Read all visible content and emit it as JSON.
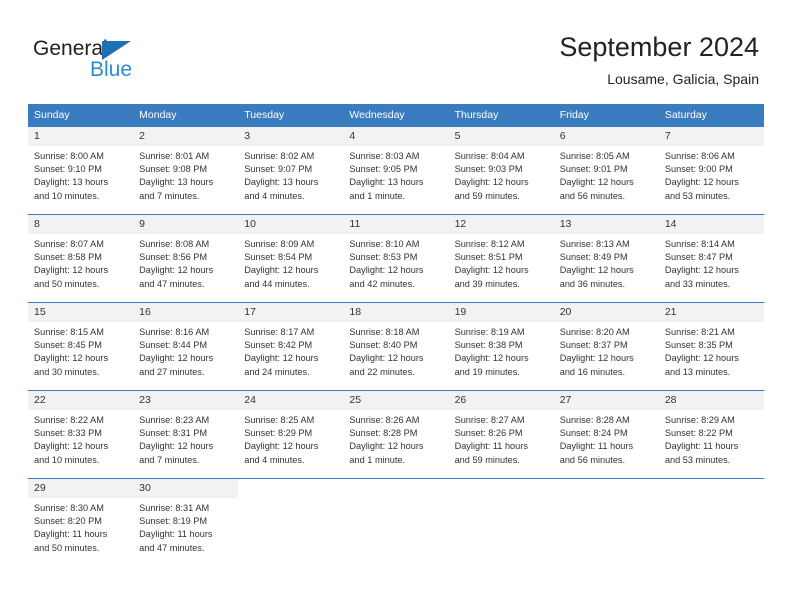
{
  "logo": {
    "word_one": "General",
    "word_two": "Blue",
    "triangle_color": "#1f6fb5",
    "blue_color": "#2e8bd0"
  },
  "header": {
    "month_title": "September 2024",
    "location": "Lousame, Galicia, Spain"
  },
  "theme": {
    "header_row_bg": "#3a7cc0",
    "daynum_bg": "#f2f2f2",
    "text_color": "#333333"
  },
  "calendar": {
    "weekday_headers": [
      "Sunday",
      "Monday",
      "Tuesday",
      "Wednesday",
      "Thursday",
      "Friday",
      "Saturday"
    ],
    "weeks": [
      [
        {
          "day": "1",
          "sunrise": "Sunrise: 8:00 AM",
          "sunset": "Sunset: 9:10 PM",
          "daylight_line1": "Daylight: 13 hours",
          "daylight_line2": "and 10 minutes."
        },
        {
          "day": "2",
          "sunrise": "Sunrise: 8:01 AM",
          "sunset": "Sunset: 9:08 PM",
          "daylight_line1": "Daylight: 13 hours",
          "daylight_line2": "and 7 minutes."
        },
        {
          "day": "3",
          "sunrise": "Sunrise: 8:02 AM",
          "sunset": "Sunset: 9:07 PM",
          "daylight_line1": "Daylight: 13 hours",
          "daylight_line2": "and 4 minutes."
        },
        {
          "day": "4",
          "sunrise": "Sunrise: 8:03 AM",
          "sunset": "Sunset: 9:05 PM",
          "daylight_line1": "Daylight: 13 hours",
          "daylight_line2": "and 1 minute."
        },
        {
          "day": "5",
          "sunrise": "Sunrise: 8:04 AM",
          "sunset": "Sunset: 9:03 PM",
          "daylight_line1": "Daylight: 12 hours",
          "daylight_line2": "and 59 minutes."
        },
        {
          "day": "6",
          "sunrise": "Sunrise: 8:05 AM",
          "sunset": "Sunset: 9:01 PM",
          "daylight_line1": "Daylight: 12 hours",
          "daylight_line2": "and 56 minutes."
        },
        {
          "day": "7",
          "sunrise": "Sunrise: 8:06 AM",
          "sunset": "Sunset: 9:00 PM",
          "daylight_line1": "Daylight: 12 hours",
          "daylight_line2": "and 53 minutes."
        }
      ],
      [
        {
          "day": "8",
          "sunrise": "Sunrise: 8:07 AM",
          "sunset": "Sunset: 8:58 PM",
          "daylight_line1": "Daylight: 12 hours",
          "daylight_line2": "and 50 minutes."
        },
        {
          "day": "9",
          "sunrise": "Sunrise: 8:08 AM",
          "sunset": "Sunset: 8:56 PM",
          "daylight_line1": "Daylight: 12 hours",
          "daylight_line2": "and 47 minutes."
        },
        {
          "day": "10",
          "sunrise": "Sunrise: 8:09 AM",
          "sunset": "Sunset: 8:54 PM",
          "daylight_line1": "Daylight: 12 hours",
          "daylight_line2": "and 44 minutes."
        },
        {
          "day": "11",
          "sunrise": "Sunrise: 8:10 AM",
          "sunset": "Sunset: 8:53 PM",
          "daylight_line1": "Daylight: 12 hours",
          "daylight_line2": "and 42 minutes."
        },
        {
          "day": "12",
          "sunrise": "Sunrise: 8:12 AM",
          "sunset": "Sunset: 8:51 PM",
          "daylight_line1": "Daylight: 12 hours",
          "daylight_line2": "and 39 minutes."
        },
        {
          "day": "13",
          "sunrise": "Sunrise: 8:13 AM",
          "sunset": "Sunset: 8:49 PM",
          "daylight_line1": "Daylight: 12 hours",
          "daylight_line2": "and 36 minutes."
        },
        {
          "day": "14",
          "sunrise": "Sunrise: 8:14 AM",
          "sunset": "Sunset: 8:47 PM",
          "daylight_line1": "Daylight: 12 hours",
          "daylight_line2": "and 33 minutes."
        }
      ],
      [
        {
          "day": "15",
          "sunrise": "Sunrise: 8:15 AM",
          "sunset": "Sunset: 8:45 PM",
          "daylight_line1": "Daylight: 12 hours",
          "daylight_line2": "and 30 minutes."
        },
        {
          "day": "16",
          "sunrise": "Sunrise: 8:16 AM",
          "sunset": "Sunset: 8:44 PM",
          "daylight_line1": "Daylight: 12 hours",
          "daylight_line2": "and 27 minutes."
        },
        {
          "day": "17",
          "sunrise": "Sunrise: 8:17 AM",
          "sunset": "Sunset: 8:42 PM",
          "daylight_line1": "Daylight: 12 hours",
          "daylight_line2": "and 24 minutes."
        },
        {
          "day": "18",
          "sunrise": "Sunrise: 8:18 AM",
          "sunset": "Sunset: 8:40 PM",
          "daylight_line1": "Daylight: 12 hours",
          "daylight_line2": "and 22 minutes."
        },
        {
          "day": "19",
          "sunrise": "Sunrise: 8:19 AM",
          "sunset": "Sunset: 8:38 PM",
          "daylight_line1": "Daylight: 12 hours",
          "daylight_line2": "and 19 minutes."
        },
        {
          "day": "20",
          "sunrise": "Sunrise: 8:20 AM",
          "sunset": "Sunset: 8:37 PM",
          "daylight_line1": "Daylight: 12 hours",
          "daylight_line2": "and 16 minutes."
        },
        {
          "day": "21",
          "sunrise": "Sunrise: 8:21 AM",
          "sunset": "Sunset: 8:35 PM",
          "daylight_line1": "Daylight: 12 hours",
          "daylight_line2": "and 13 minutes."
        }
      ],
      [
        {
          "day": "22",
          "sunrise": "Sunrise: 8:22 AM",
          "sunset": "Sunset: 8:33 PM",
          "daylight_line1": "Daylight: 12 hours",
          "daylight_line2": "and 10 minutes."
        },
        {
          "day": "23",
          "sunrise": "Sunrise: 8:23 AM",
          "sunset": "Sunset: 8:31 PM",
          "daylight_line1": "Daylight: 12 hours",
          "daylight_line2": "and 7 minutes."
        },
        {
          "day": "24",
          "sunrise": "Sunrise: 8:25 AM",
          "sunset": "Sunset: 8:29 PM",
          "daylight_line1": "Daylight: 12 hours",
          "daylight_line2": "and 4 minutes."
        },
        {
          "day": "25",
          "sunrise": "Sunrise: 8:26 AM",
          "sunset": "Sunset: 8:28 PM",
          "daylight_line1": "Daylight: 12 hours",
          "daylight_line2": "and 1 minute."
        },
        {
          "day": "26",
          "sunrise": "Sunrise: 8:27 AM",
          "sunset": "Sunset: 8:26 PM",
          "daylight_line1": "Daylight: 11 hours",
          "daylight_line2": "and 59 minutes."
        },
        {
          "day": "27",
          "sunrise": "Sunrise: 8:28 AM",
          "sunset": "Sunset: 8:24 PM",
          "daylight_line1": "Daylight: 11 hours",
          "daylight_line2": "and 56 minutes."
        },
        {
          "day": "28",
          "sunrise": "Sunrise: 8:29 AM",
          "sunset": "Sunset: 8:22 PM",
          "daylight_line1": "Daylight: 11 hours",
          "daylight_line2": "and 53 minutes."
        }
      ],
      [
        {
          "day": "29",
          "sunrise": "Sunrise: 8:30 AM",
          "sunset": "Sunset: 8:20 PM",
          "daylight_line1": "Daylight: 11 hours",
          "daylight_line2": "and 50 minutes."
        },
        {
          "day": "30",
          "sunrise": "Sunrise: 8:31 AM",
          "sunset": "Sunset: 8:19 PM",
          "daylight_line1": "Daylight: 11 hours",
          "daylight_line2": "and 47 minutes."
        },
        {
          "day": "",
          "sunrise": "",
          "sunset": "",
          "daylight_line1": "",
          "daylight_line2": ""
        },
        {
          "day": "",
          "sunrise": "",
          "sunset": "",
          "daylight_line1": "",
          "daylight_line2": ""
        },
        {
          "day": "",
          "sunrise": "",
          "sunset": "",
          "daylight_line1": "",
          "daylight_line2": ""
        },
        {
          "day": "",
          "sunrise": "",
          "sunset": "",
          "daylight_line1": "",
          "daylight_line2": ""
        },
        {
          "day": "",
          "sunrise": "",
          "sunset": "",
          "daylight_line1": "",
          "daylight_line2": ""
        }
      ]
    ]
  }
}
